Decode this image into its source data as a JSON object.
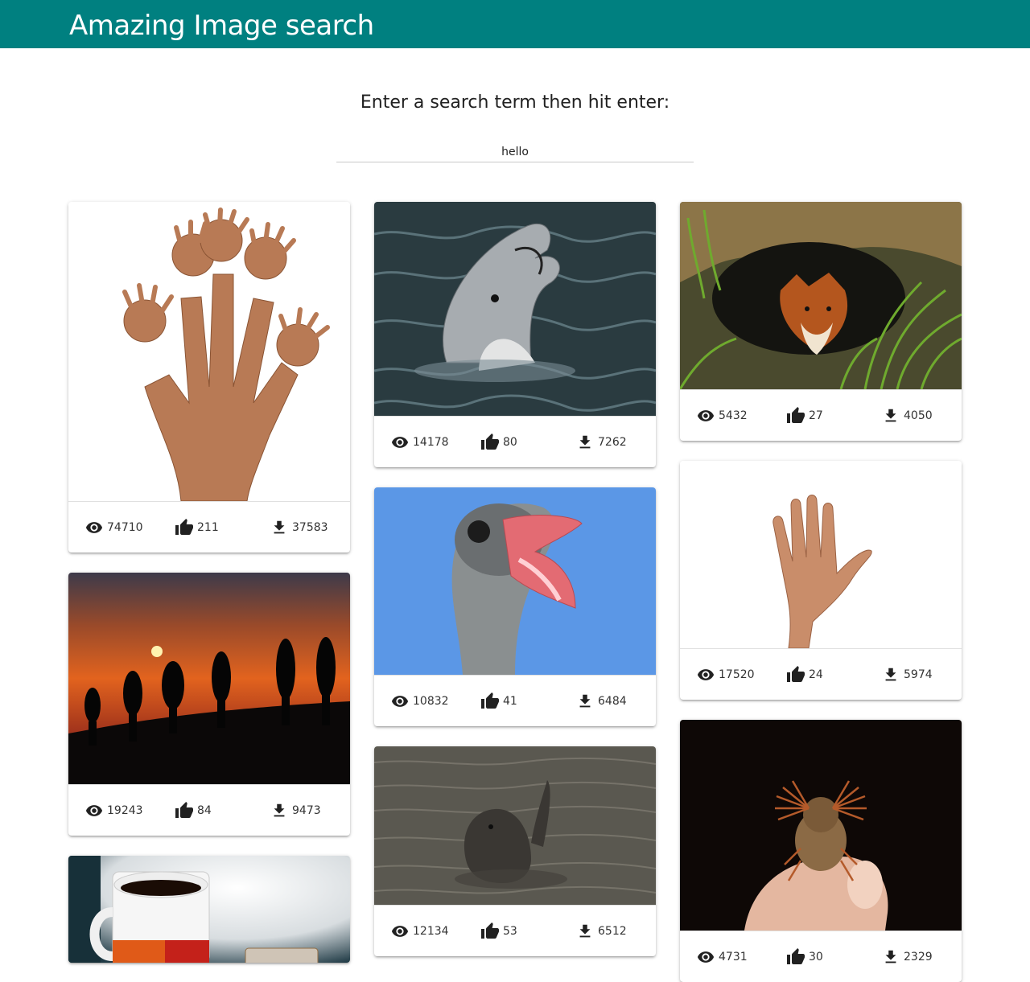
{
  "app": {
    "title": "Amazing Image search"
  },
  "search": {
    "prompt": "Enter a search term then hit enter:",
    "value": "hello"
  },
  "cards": [
    {
      "subject": "many-hands",
      "views": "74710",
      "likes": "211",
      "downloads": "37583"
    },
    {
      "subject": "hikers-sunset",
      "views": "19243",
      "likes": "84",
      "downloads": "9473"
    },
    {
      "subject": "coffee-mug",
      "views": "",
      "likes": "",
      "downloads": ""
    },
    {
      "subject": "dolphin",
      "views": "14178",
      "likes": "80",
      "downloads": "7262"
    },
    {
      "subject": "ostrich",
      "views": "10832",
      "likes": "41",
      "downloads": "6484"
    },
    {
      "subject": "seal-waving",
      "views": "12134",
      "likes": "53",
      "downloads": "6512"
    },
    {
      "subject": "fox-in-den",
      "views": "5432",
      "likes": "27",
      "downloads": "4050"
    },
    {
      "subject": "waving-hand",
      "views": "17520",
      "likes": "24",
      "downloads": "5974"
    },
    {
      "subject": "beetle-on-finger",
      "views": "4731",
      "likes": "30",
      "downloads": "2329"
    }
  ],
  "colors": {
    "appbar": "#008080",
    "background": "#ffffff",
    "icon": "#212121"
  },
  "icons": {
    "views": "eye-icon",
    "likes": "thumb-up-icon",
    "downloads": "download-icon"
  }
}
